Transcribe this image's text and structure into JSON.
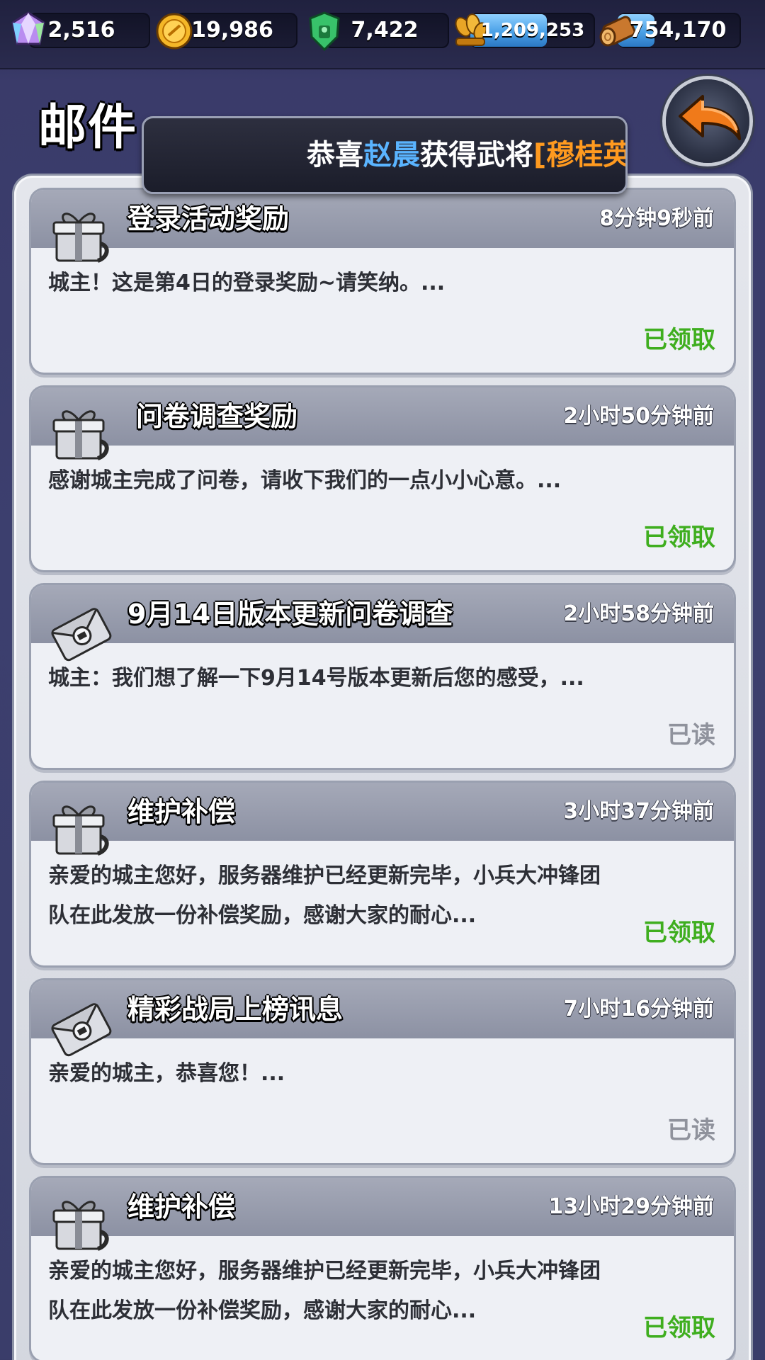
{
  "resources": [
    {
      "name": "gem",
      "icon": "gem-icon",
      "value": "2,516"
    },
    {
      "name": "gold",
      "icon": "gold-coin-icon",
      "value": "19,986"
    },
    {
      "name": "jade",
      "icon": "green-shield-icon",
      "value": "7,422"
    },
    {
      "name": "grain",
      "icon": "wheat-icon",
      "value": "1,209,253",
      "fill": 0.6
    },
    {
      "name": "wood",
      "icon": "wood-log-icon",
      "value": "754,170",
      "fill": 0.3
    }
  ],
  "header": {
    "title": "邮件",
    "back_icon": "back-arrow-icon"
  },
  "broadcast": {
    "prefix": "恭喜",
    "player": "赵晨",
    "middle": "获得武将",
    "hero": "[穆桂英"
  },
  "mails": [
    {
      "icon": "gift-box-icon",
      "subject": "登录活动奖励",
      "time": "8分钟9秒前",
      "body": "城主！这是第4日的登录奖励~请笑纳。...",
      "status": "已领取",
      "status_type": "claimed"
    },
    {
      "icon": "gift-box-icon",
      "subject": "问卷调查奖励",
      "time": "2小时50分钟前",
      "body": "感谢城主完成了问卷，请收下我们的一点小小心意。...",
      "status": "已领取",
      "status_type": "claimed"
    },
    {
      "icon": "envelope-icon",
      "subject": "9月14日版本更新问卷调查",
      "time": "2小时58分钟前",
      "body": "城主：我们想了解一下9月14号版本更新后您的感受，...",
      "status": "已读",
      "status_type": "read"
    },
    {
      "icon": "gift-box-icon",
      "subject": "维护补偿",
      "time": "3小时37分钟前",
      "body": "亲爱的城主您好，服务器维护已经更新完毕，小兵大冲锋团队在此发放一份补偿奖励，感谢大家的耐心...",
      "status": "已领取",
      "status_type": "claimed"
    },
    {
      "icon": "envelope-icon",
      "subject": "精彩战局上榜讯息",
      "time": "7小时16分钟前",
      "body": "亲爱的城主，恭喜您！...",
      "status": "已读",
      "status_type": "read"
    },
    {
      "icon": "gift-box-icon",
      "subject": "维护补偿",
      "time": "13小时29分钟前",
      "body": "亲爱的城主您好，服务器维护已经更新完毕，小兵大冲锋团队在此发放一份补偿奖励，感谢大家的耐心...",
      "status": "已领取",
      "status_type": "claimed"
    }
  ]
}
